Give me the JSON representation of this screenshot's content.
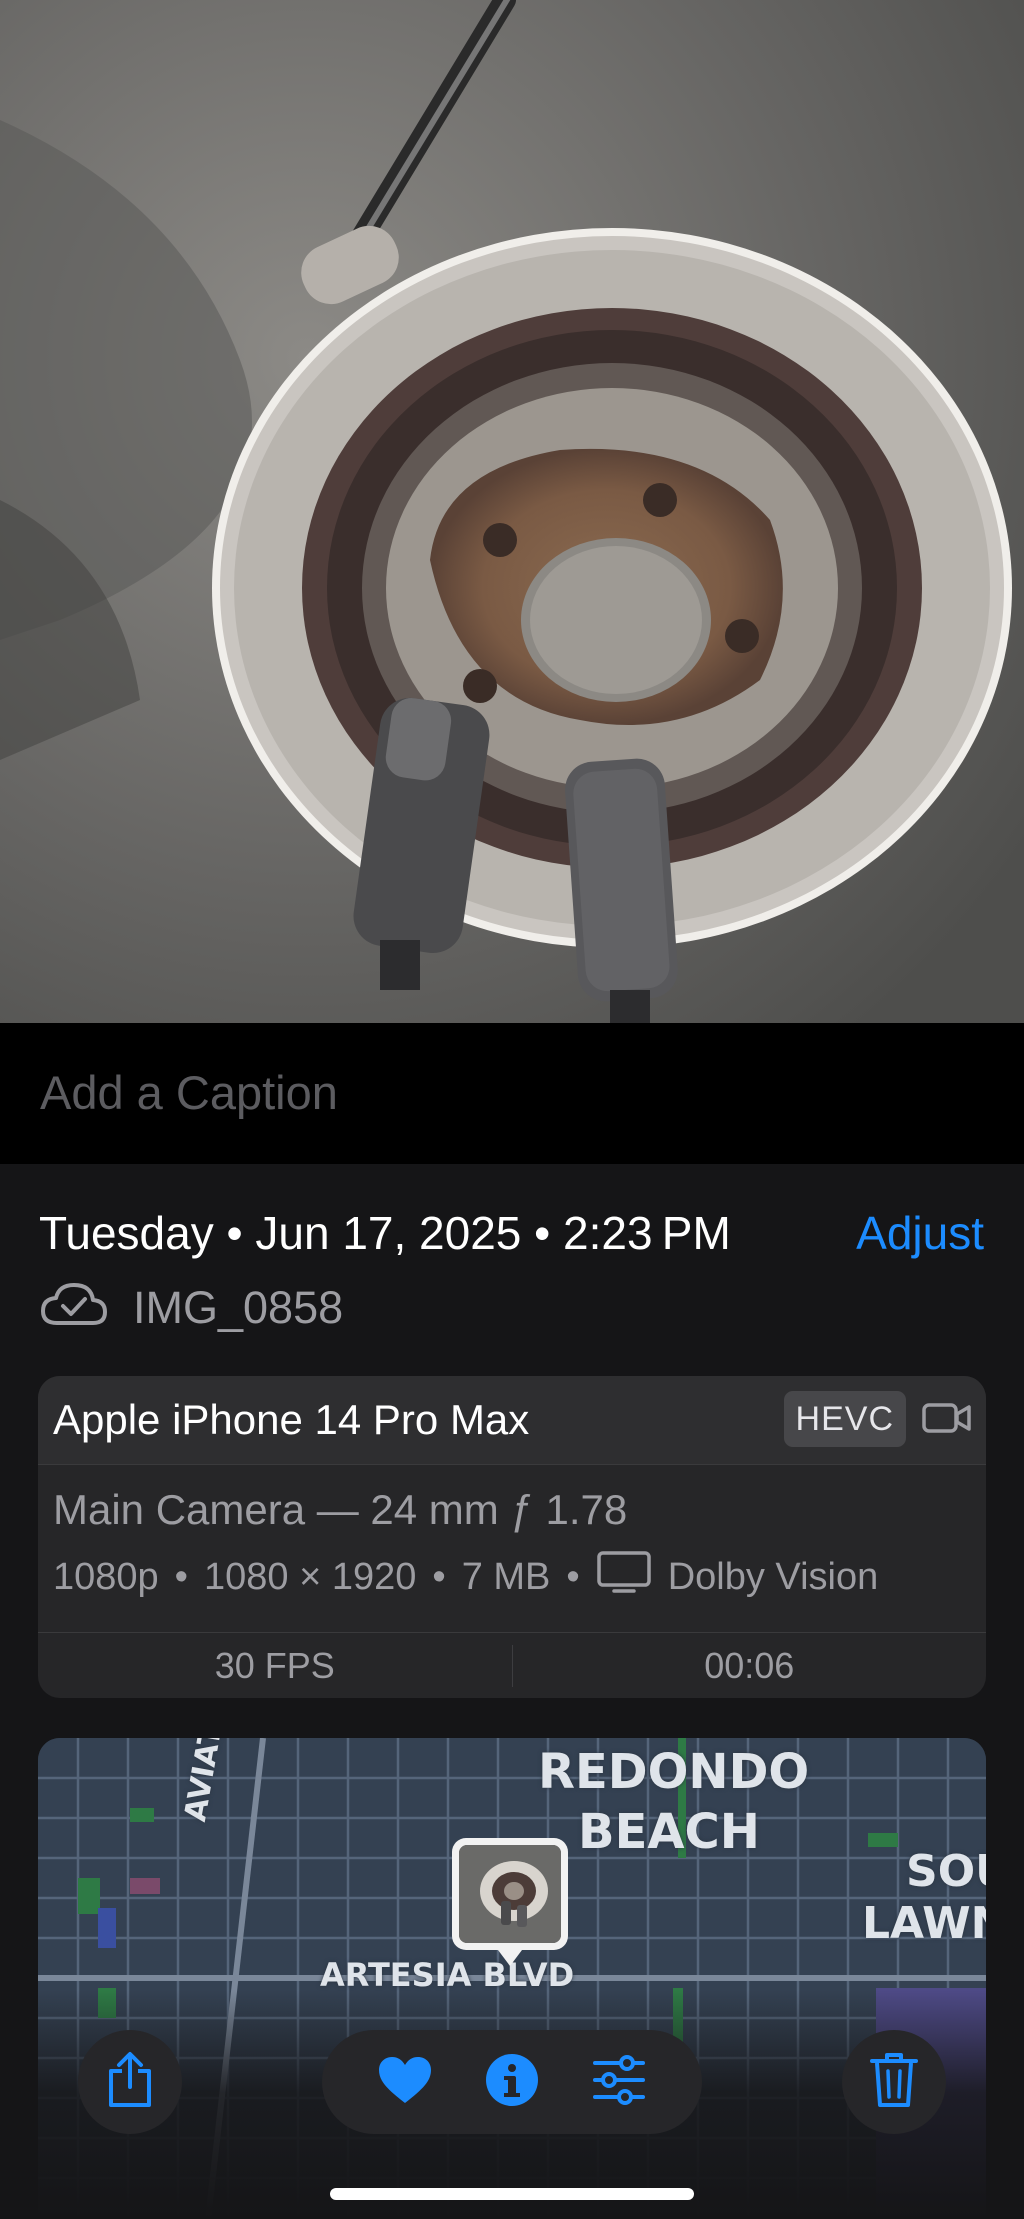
{
  "photo": {
    "description_icon": "photo"
  },
  "caption": {
    "placeholder": "Add a Caption"
  },
  "meta": {
    "date_line": "Tuesday • Jun 17, 2025 • 2:23 PM",
    "adjust_label": "Adjust",
    "filename": "IMG_0858"
  },
  "device_card": {
    "device": "Apple iPhone 14 Pro Max",
    "codec_badge": "HEVC",
    "lens": "Main Camera — 24 mm ƒ 1.78",
    "resolution": "1080p",
    "dimensions": "1080 × 1920",
    "size": "7 MB",
    "hdr": "Dolby Vision",
    "fps": "30 FPS",
    "duration": "00:06",
    "sep": "•"
  },
  "map": {
    "labels": {
      "city_line1": "REDONDO",
      "city_line2": "BEACH",
      "aviation": "AVIATION",
      "artesia": "ARTESIA BLVD",
      "south_line1": "SOU",
      "south_line2": "LAWN"
    }
  },
  "toolbar": {
    "share_icon": "share-icon",
    "favorite_icon": "heart-icon",
    "info_icon": "info-icon",
    "edit_icon": "sliders-icon",
    "delete_icon": "trash-icon"
  },
  "colors": {
    "accent": "#1c8cff",
    "background": "#151517",
    "card": "#262628"
  }
}
